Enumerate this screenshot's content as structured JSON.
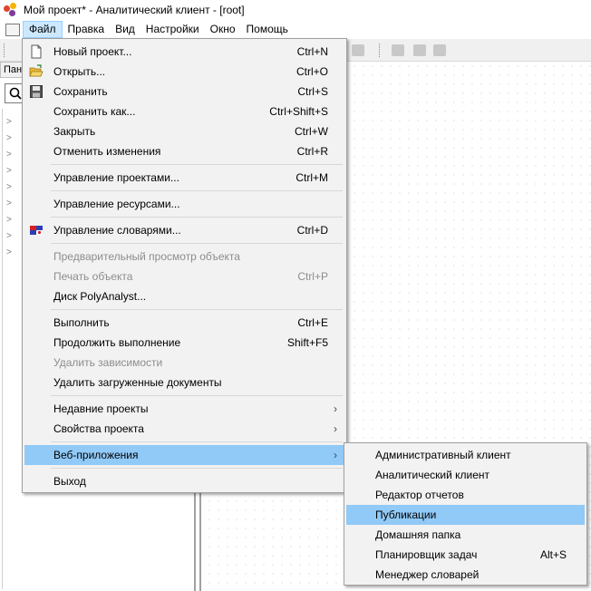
{
  "window": {
    "title": "Мой проект* - Аналитический клиент - [root]"
  },
  "menubar": {
    "items": [
      "Файл",
      "Правка",
      "Вид",
      "Настройки",
      "Окно",
      "Помощь"
    ]
  },
  "left_panel": {
    "tab_label": "Пан"
  },
  "file_menu": {
    "new_project": {
      "label": "Новый проект...",
      "shortcut": "Ctrl+N"
    },
    "open": {
      "label": "Открыть...",
      "shortcut": "Ctrl+O"
    },
    "save": {
      "label": "Сохранить",
      "shortcut": "Ctrl+S"
    },
    "save_as": {
      "label": "Сохранить как...",
      "shortcut": "Ctrl+Shift+S"
    },
    "close": {
      "label": "Закрыть",
      "shortcut": "Ctrl+W"
    },
    "revert": {
      "label": "Отменить изменения",
      "shortcut": "Ctrl+R"
    },
    "manage_projects": {
      "label": "Управление проектами...",
      "shortcut": "Ctrl+M"
    },
    "manage_resources": {
      "label": "Управление ресурсами..."
    },
    "manage_dictionaries": {
      "label": "Управление словарями...",
      "shortcut": "Ctrl+D"
    },
    "preview_object": {
      "label": "Предварительный просмотр объекта"
    },
    "print_object": {
      "label": "Печать объекта",
      "shortcut": "Ctrl+P"
    },
    "polyanalyst_disk": {
      "label": "Диск PolyAnalyst..."
    },
    "execute": {
      "label": "Выполнить",
      "shortcut": "Ctrl+E"
    },
    "continue_execution": {
      "label": "Продолжить выполнение",
      "shortcut": "Shift+F5"
    },
    "delete_dependencies": {
      "label": "Удалить зависимости"
    },
    "delete_loaded_documents": {
      "label": "Удалить загруженные документы"
    },
    "recent_projects": {
      "label": "Недавние проекты"
    },
    "project_properties": {
      "label": "Свойства проекта"
    },
    "web_apps": {
      "label": "Веб-приложения"
    },
    "exit": {
      "label": "Выход"
    }
  },
  "web_apps_submenu": {
    "items": [
      {
        "label": "Административный клиент"
      },
      {
        "label": "Аналитический клиент"
      },
      {
        "label": "Редактор отчетов"
      },
      {
        "label": "Публикации"
      },
      {
        "label": "Домашняя папка"
      },
      {
        "label": "Планировщик задач",
        "shortcut": "Alt+S"
      },
      {
        "label": "Менеджер словарей"
      }
    ]
  },
  "colors": {
    "highlight": "#91c9f7",
    "menu_bg": "#f2f2f2",
    "active_menubar": "#cce8ff"
  },
  "icons": {
    "app": "polyanalyst-logo-icon",
    "new": "blank-document-icon",
    "open": "open-folder-icon",
    "save": "floppy-disk-icon",
    "dictionaries": "dictionary-flag-icon",
    "submenu": "chevron-right-icon",
    "search": "search-icon"
  }
}
